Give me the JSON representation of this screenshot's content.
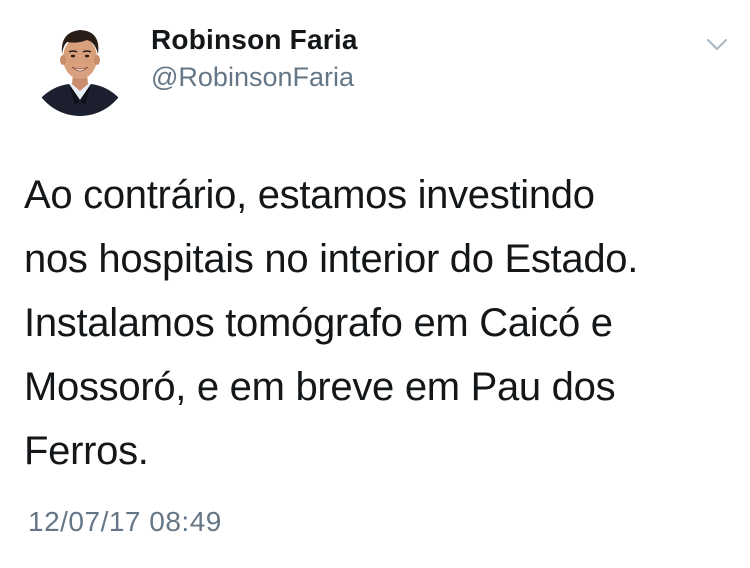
{
  "user": {
    "display_name": "Robinson Faria",
    "handle": "@RobinsonFaria"
  },
  "tweet": {
    "lines": [
      "Ao contrário, estamos investindo",
      "nos hospitais no interior do Estado.",
      "Instalamos tomógrafo em Caicó e",
      "Mossoró, e em breve em Pau dos",
      "Ferros."
    ],
    "timestamp": "12/07/17 08:49"
  },
  "icons": {
    "menu": "chevron-down-icon"
  },
  "colors": {
    "text": "#14171a",
    "secondary": "#657786",
    "chevron": "#aab8c2",
    "background": "#ffffff"
  }
}
